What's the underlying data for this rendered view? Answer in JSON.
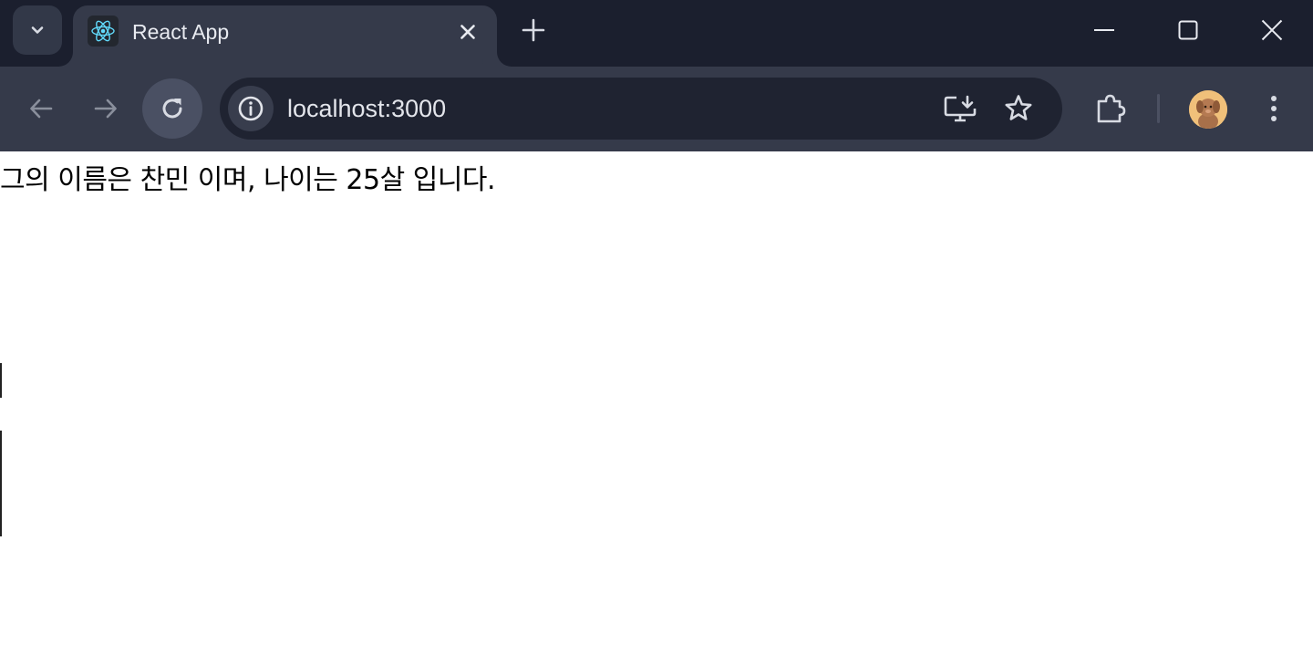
{
  "colors": {
    "tabstrip_bg": "#1b1f2e",
    "toolbar_bg": "#353a4a",
    "omnibox_bg": "#1f2331",
    "icon_color": "#d8dbe3",
    "icon_disabled": "#8a8f9c",
    "page_bg": "#ffffff",
    "page_text": "#000000"
  },
  "tabstrip": {
    "tab_search_icon": "chevron-down-icon",
    "active_tab": {
      "favicon": "react-logo-icon",
      "title": "React App",
      "close_icon": "close-icon"
    },
    "new_tab_icon": "plus-icon",
    "window_controls": [
      "minimize-icon",
      "maximize-icon",
      "close-icon"
    ]
  },
  "toolbar": {
    "back_icon": "arrow-left-icon",
    "forward_icon": "arrow-right-icon",
    "reload_icon": "reload-icon",
    "omnibox": {
      "site_info_icon": "info-icon",
      "url": "localhost:3000",
      "install_icon": "install-app-icon",
      "bookmark_icon": "star-icon"
    },
    "extensions_icon": "puzzle-icon",
    "profile_avatar": "profile-avatar",
    "menu_icon": "kebab-menu-icon"
  },
  "page": {
    "text": "그의 이름은 찬민 이며, 나이는 25살 입니다."
  }
}
